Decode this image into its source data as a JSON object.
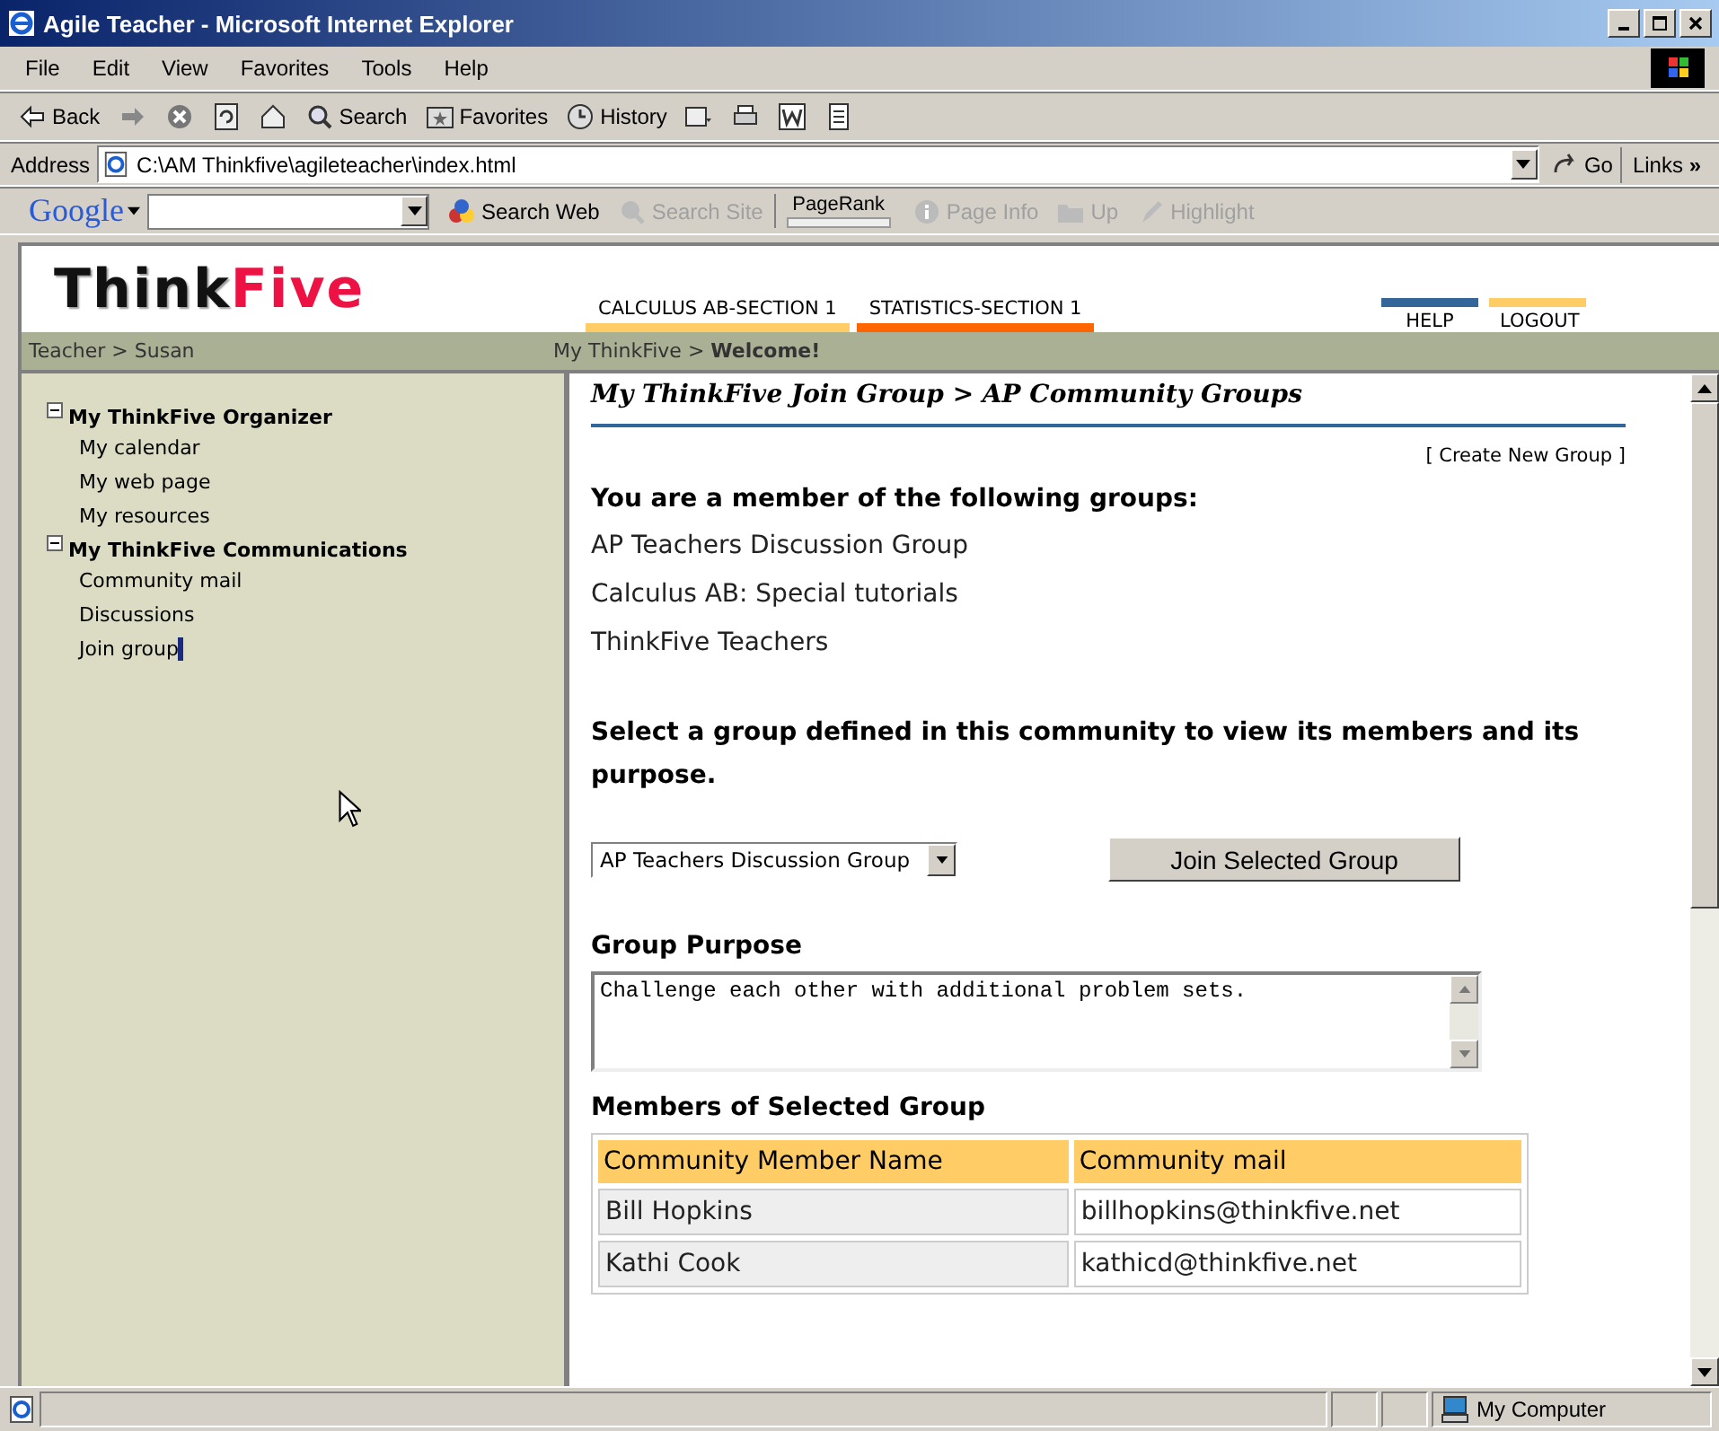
{
  "window": {
    "title": "Agile Teacher - Microsoft Internet Explorer"
  },
  "menu": [
    "File",
    "Edit",
    "View",
    "Favorites",
    "Tools",
    "Help"
  ],
  "toolbar": [
    {
      "kind": "back",
      "label": "Back"
    },
    {
      "kind": "forward"
    },
    {
      "kind": "stop"
    },
    {
      "kind": "refresh"
    },
    {
      "kind": "home"
    },
    {
      "kind": "search",
      "label": "Search"
    },
    {
      "kind": "favorites",
      "label": "Favorites"
    },
    {
      "kind": "history",
      "label": "History"
    },
    {
      "kind": "mail"
    },
    {
      "kind": "print"
    },
    {
      "kind": "edit"
    },
    {
      "kind": "discuss"
    }
  ],
  "address": {
    "label": "Address",
    "value": "C:\\AM Thinkfive\\agileteacher\\index.html",
    "go": "Go",
    "links": "Links",
    "more": "»"
  },
  "google_bar": {
    "logo": "Google",
    "items": [
      {
        "kind": "search_web",
        "label": "Search Web",
        "disabled": false
      },
      {
        "kind": "search_site",
        "label": "Search Site",
        "disabled": true
      },
      {
        "kind": "pagerank",
        "label": "PageRank",
        "disabled": false
      },
      {
        "kind": "page_info",
        "label": "Page Info",
        "disabled": true
      },
      {
        "kind": "up",
        "label": "Up",
        "disabled": true
      },
      {
        "kind": "highlight",
        "label": "Highlight",
        "disabled": true
      }
    ]
  },
  "site": {
    "logo_first": "Think",
    "logo_second": "Five",
    "tabs": [
      {
        "label": "CALCULUS AB-SECTION 1",
        "color": "#ffcc66"
      },
      {
        "label": "STATISTICS-SECTION 1",
        "color": "#ff6600"
      }
    ],
    "links": [
      {
        "label": "HELP",
        "color": "#336699"
      },
      {
        "label": "LOGOUT",
        "color": "#ffcc66"
      }
    ]
  },
  "breadcrumb": {
    "left": "Teacher > Susan",
    "right": "My ThinkFive > **Welcome!**"
  },
  "sidebar": {
    "groups": [
      {
        "label": "My ThinkFive Organizer",
        "expanded": true,
        "children": [
          {
            "label": "My calendar",
            "selected": false
          },
          {
            "label": "My web page",
            "selected": false
          },
          {
            "label": "My resources",
            "selected": false
          }
        ]
      },
      {
        "label": "My ThinkFive Communications",
        "expanded": true,
        "children": [
          {
            "label": "Community mail",
            "selected": false
          },
          {
            "label": "Discussions",
            "selected": false
          },
          {
            "label": "Join group",
            "selected": true
          }
        ]
      }
    ]
  },
  "content": {
    "title": "My ThinkFive Join Group > AP Community Groups",
    "create_link": "[ Create New Group ]",
    "member_heading": "You are a member of the following groups:",
    "member_groups": [
      "AP Teachers Discussion Group",
      "Calculus AB: Special tutorials",
      "ThinkFive Teachers"
    ],
    "select_heading": "Select a group defined in this community to view its members and its purpose.",
    "group_select": {
      "value": "AP Teachers Discussion Group"
    },
    "join_button": "Join Selected Group",
    "purpose_heading": "Group Purpose",
    "purpose_text": "Challenge each other with additional problem sets.",
    "members_heading": "Members of Selected Group",
    "table": {
      "columns": [
        "Community Member Name",
        "Community mail"
      ],
      "rows": [
        [
          "Bill Hopkins",
          "billhopkins@thinkfive.net"
        ],
        [
          "Kathi Cook",
          "kathicd@thinkfive.net"
        ]
      ]
    }
  },
  "status_bar": {
    "zone": "My Computer"
  }
}
